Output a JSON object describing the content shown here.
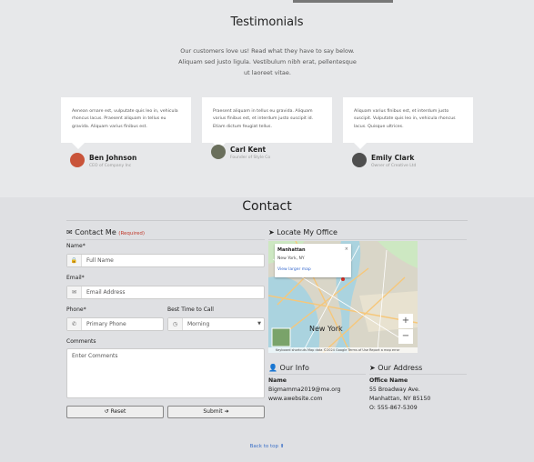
{
  "testimonials": {
    "title": "Testimonials",
    "subtitle": "Our customers love us! Read what they have to say below. Aliquam sed justo ligula. Vestibulum nibh erat, pellentesque ut laoreet vitae.",
    "cards": [
      {
        "text": "Aenean ornare est, vulputate quis leo in, vehicula rhoncus lacus. Praesent aliquam in tellus eu gravida. Aliquam varius finibus est.",
        "name": "Ben Johnson",
        "role": "CEO of Company Inc",
        "avatar_color": "#c9543a"
      },
      {
        "text": "Praesent aliquam in tellus eu gravida. Aliquam varius finibus est, et interdum justo suscipit id. Etiam dictum feugiat tellus.",
        "name": "Carl Kent",
        "role": "Founder of Style Co",
        "avatar_color": "#6a6f5c"
      },
      {
        "text": "Aliquam varius finibus est, et interdum justo suscipit. Vulputate quis leo in, vehicula rhoncus lacus. Quisque ultrices.",
        "name": "Emily Clark",
        "role": "Owner of Creative Ltd",
        "avatar_color": "#4f4f4f"
      }
    ]
  },
  "contact": {
    "title": "Contact",
    "form": {
      "heading": "Contact Me",
      "required_note": "(Required)",
      "name_label": "Name*",
      "name_placeholder": "Full Name",
      "email_label": "Email*",
      "email_placeholder": "Email Address",
      "phone_label": "Phone*",
      "phone_placeholder": "Primary Phone",
      "best_time_label": "Best Time to Call",
      "best_time_value": "Morning",
      "comments_label": "Comments",
      "comments_placeholder": "Enter Comments",
      "reset_label": "Reset",
      "submit_label": "Submit"
    },
    "map": {
      "heading": "Locate My Office",
      "info_title": "Manhattan",
      "info_sub": "New York, NY",
      "info_link": "View larger map",
      "city_label": "New York",
      "footer": "Keyboard shortcuts   Map data ©2024 Google   Terms of Use   Report a map error",
      "zoom_in": "+",
      "zoom_out": "−"
    },
    "info": {
      "heading": "Our Info",
      "name_label": "Name",
      "email": "Bigmamma2019@me.org",
      "website": "www.awebsite.com"
    },
    "address": {
      "heading": "Our Address",
      "office_label": "Office Name",
      "street": "55 Broadway Ave.",
      "city": "Manhattan, NY 85150",
      "phone": "O: 555-867-5309"
    },
    "back_to_top": "Back to top"
  },
  "colors": {
    "required": "#c0392b",
    "link": "#3a6fc7"
  }
}
